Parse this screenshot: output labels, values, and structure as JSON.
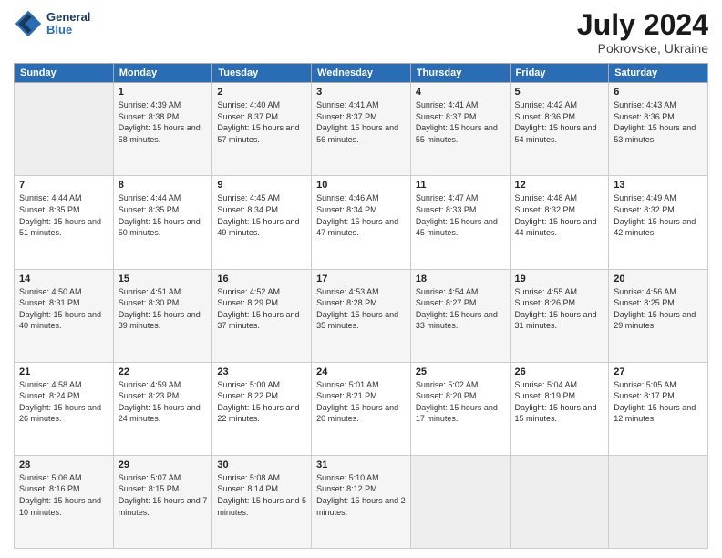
{
  "header": {
    "logo": {
      "line1": "General",
      "line2": "Blue"
    },
    "title": "July 2024",
    "location": "Pokrovske, Ukraine"
  },
  "weekdays": [
    "Sunday",
    "Monday",
    "Tuesday",
    "Wednesday",
    "Thursday",
    "Friday",
    "Saturday"
  ],
  "weeks": [
    [
      {
        "day": "",
        "empty": true
      },
      {
        "day": "1",
        "sunrise": "Sunrise: 4:39 AM",
        "sunset": "Sunset: 8:38 PM",
        "daylight": "Daylight: 15 hours and 58 minutes."
      },
      {
        "day": "2",
        "sunrise": "Sunrise: 4:40 AM",
        "sunset": "Sunset: 8:37 PM",
        "daylight": "Daylight: 15 hours and 57 minutes."
      },
      {
        "day": "3",
        "sunrise": "Sunrise: 4:41 AM",
        "sunset": "Sunset: 8:37 PM",
        "daylight": "Daylight: 15 hours and 56 minutes."
      },
      {
        "day": "4",
        "sunrise": "Sunrise: 4:41 AM",
        "sunset": "Sunset: 8:37 PM",
        "daylight": "Daylight: 15 hours and 55 minutes."
      },
      {
        "day": "5",
        "sunrise": "Sunrise: 4:42 AM",
        "sunset": "Sunset: 8:36 PM",
        "daylight": "Daylight: 15 hours and 54 minutes."
      },
      {
        "day": "6",
        "sunrise": "Sunrise: 4:43 AM",
        "sunset": "Sunset: 8:36 PM",
        "daylight": "Daylight: 15 hours and 53 minutes."
      }
    ],
    [
      {
        "day": "7",
        "sunrise": "Sunrise: 4:44 AM",
        "sunset": "Sunset: 8:35 PM",
        "daylight": "Daylight: 15 hours and 51 minutes."
      },
      {
        "day": "8",
        "sunrise": "Sunrise: 4:44 AM",
        "sunset": "Sunset: 8:35 PM",
        "daylight": "Daylight: 15 hours and 50 minutes."
      },
      {
        "day": "9",
        "sunrise": "Sunrise: 4:45 AM",
        "sunset": "Sunset: 8:34 PM",
        "daylight": "Daylight: 15 hours and 49 minutes."
      },
      {
        "day": "10",
        "sunrise": "Sunrise: 4:46 AM",
        "sunset": "Sunset: 8:34 PM",
        "daylight": "Daylight: 15 hours and 47 minutes."
      },
      {
        "day": "11",
        "sunrise": "Sunrise: 4:47 AM",
        "sunset": "Sunset: 8:33 PM",
        "daylight": "Daylight: 15 hours and 45 minutes."
      },
      {
        "day": "12",
        "sunrise": "Sunrise: 4:48 AM",
        "sunset": "Sunset: 8:32 PM",
        "daylight": "Daylight: 15 hours and 44 minutes."
      },
      {
        "day": "13",
        "sunrise": "Sunrise: 4:49 AM",
        "sunset": "Sunset: 8:32 PM",
        "daylight": "Daylight: 15 hours and 42 minutes."
      }
    ],
    [
      {
        "day": "14",
        "sunrise": "Sunrise: 4:50 AM",
        "sunset": "Sunset: 8:31 PM",
        "daylight": "Daylight: 15 hours and 40 minutes."
      },
      {
        "day": "15",
        "sunrise": "Sunrise: 4:51 AM",
        "sunset": "Sunset: 8:30 PM",
        "daylight": "Daylight: 15 hours and 39 minutes."
      },
      {
        "day": "16",
        "sunrise": "Sunrise: 4:52 AM",
        "sunset": "Sunset: 8:29 PM",
        "daylight": "Daylight: 15 hours and 37 minutes."
      },
      {
        "day": "17",
        "sunrise": "Sunrise: 4:53 AM",
        "sunset": "Sunset: 8:28 PM",
        "daylight": "Daylight: 15 hours and 35 minutes."
      },
      {
        "day": "18",
        "sunrise": "Sunrise: 4:54 AM",
        "sunset": "Sunset: 8:27 PM",
        "daylight": "Daylight: 15 hours and 33 minutes."
      },
      {
        "day": "19",
        "sunrise": "Sunrise: 4:55 AM",
        "sunset": "Sunset: 8:26 PM",
        "daylight": "Daylight: 15 hours and 31 minutes."
      },
      {
        "day": "20",
        "sunrise": "Sunrise: 4:56 AM",
        "sunset": "Sunset: 8:25 PM",
        "daylight": "Daylight: 15 hours and 29 minutes."
      }
    ],
    [
      {
        "day": "21",
        "sunrise": "Sunrise: 4:58 AM",
        "sunset": "Sunset: 8:24 PM",
        "daylight": "Daylight: 15 hours and 26 minutes."
      },
      {
        "day": "22",
        "sunrise": "Sunrise: 4:59 AM",
        "sunset": "Sunset: 8:23 PM",
        "daylight": "Daylight: 15 hours and 24 minutes."
      },
      {
        "day": "23",
        "sunrise": "Sunrise: 5:00 AM",
        "sunset": "Sunset: 8:22 PM",
        "daylight": "Daylight: 15 hours and 22 minutes."
      },
      {
        "day": "24",
        "sunrise": "Sunrise: 5:01 AM",
        "sunset": "Sunset: 8:21 PM",
        "daylight": "Daylight: 15 hours and 20 minutes."
      },
      {
        "day": "25",
        "sunrise": "Sunrise: 5:02 AM",
        "sunset": "Sunset: 8:20 PM",
        "daylight": "Daylight: 15 hours and 17 minutes."
      },
      {
        "day": "26",
        "sunrise": "Sunrise: 5:04 AM",
        "sunset": "Sunset: 8:19 PM",
        "daylight": "Daylight: 15 hours and 15 minutes."
      },
      {
        "day": "27",
        "sunrise": "Sunrise: 5:05 AM",
        "sunset": "Sunset: 8:17 PM",
        "daylight": "Daylight: 15 hours and 12 minutes."
      }
    ],
    [
      {
        "day": "28",
        "sunrise": "Sunrise: 5:06 AM",
        "sunset": "Sunset: 8:16 PM",
        "daylight": "Daylight: 15 hours and 10 minutes."
      },
      {
        "day": "29",
        "sunrise": "Sunrise: 5:07 AM",
        "sunset": "Sunset: 8:15 PM",
        "daylight": "Daylight: 15 hours and 7 minutes."
      },
      {
        "day": "30",
        "sunrise": "Sunrise: 5:08 AM",
        "sunset": "Sunset: 8:14 PM",
        "daylight": "Daylight: 15 hours and 5 minutes."
      },
      {
        "day": "31",
        "sunrise": "Sunrise: 5:10 AM",
        "sunset": "Sunset: 8:12 PM",
        "daylight": "Daylight: 15 hours and 2 minutes."
      },
      {
        "day": "",
        "empty": true
      },
      {
        "day": "",
        "empty": true
      },
      {
        "day": "",
        "empty": true
      }
    ]
  ]
}
